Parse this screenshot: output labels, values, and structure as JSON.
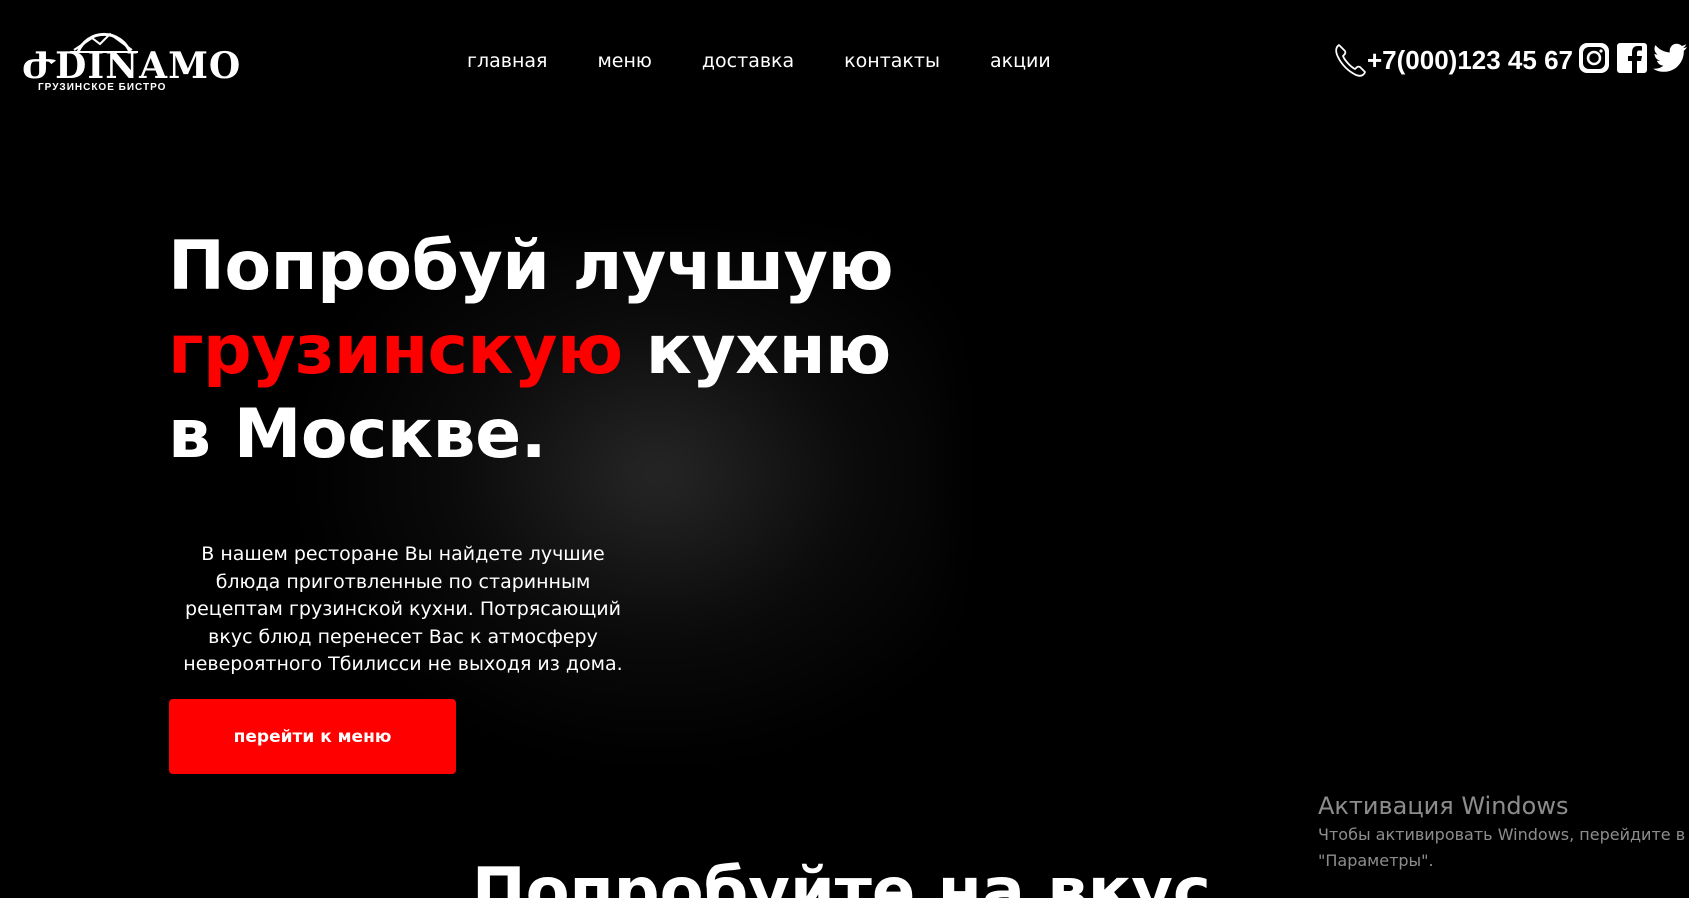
{
  "header": {
    "logo": {
      "name": "ԺDINAMO",
      "subtitle": "ГРУЗИНСКОЕ БИСТРО",
      "icon": "mountain-logo-icon"
    },
    "nav": [
      {
        "label": "главная"
      },
      {
        "label": "меню"
      },
      {
        "label": "доставка"
      },
      {
        "label": "контакты"
      },
      {
        "label": "акции"
      }
    ],
    "phone": "+7(000)123 45 67",
    "phone_icon": "phone-icon",
    "social": [
      {
        "icon": "instagram-icon"
      },
      {
        "icon": "facebook-icon"
      },
      {
        "icon": "twitter-icon"
      }
    ]
  },
  "hero": {
    "title_line1": "Попробуй лучшую",
    "title_line2_accent": "грузинскую",
    "title_line2_rest": " кухню",
    "title_line3": "в Москве.",
    "description": "В нашем ресторане Вы найдете лучшие блюда приготвленные по старинным рецептам грузинской кухни. Потрясающий вкус блюд перенесет Вас к атмосферу невероятного Тбилисси не выходя из дома.",
    "cta_label": "перейти к меню"
  },
  "next_section": {
    "title": "Попробуйте на вкус"
  },
  "watermark": {
    "title": "Активация Windows",
    "line1": "Чтобы активировать Windows, перейдите в р",
    "line2": "\"Параметры\"."
  },
  "colors": {
    "background": "#000000",
    "accent": "#ff0000",
    "text": "#ffffff"
  }
}
